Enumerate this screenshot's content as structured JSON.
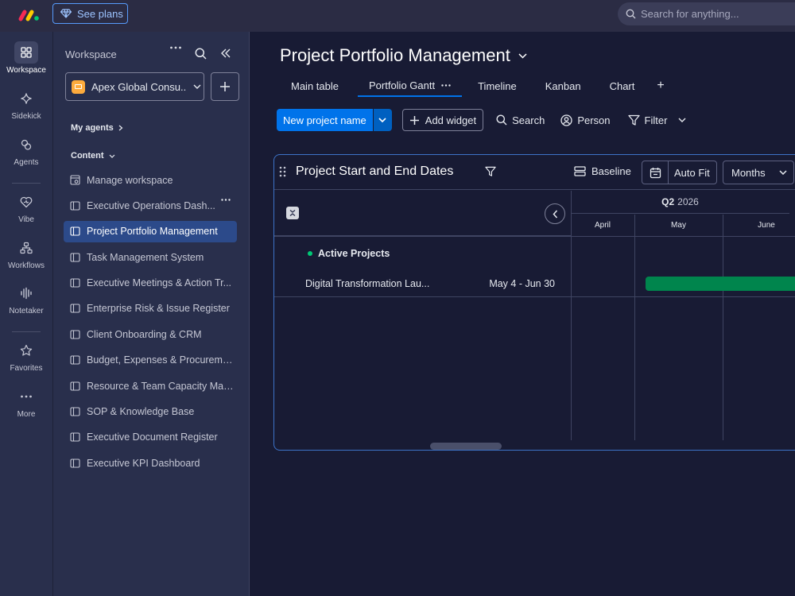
{
  "topbar": {
    "see_plans": "See plans",
    "search_placeholder": "Search for anything..."
  },
  "rail": {
    "items": [
      {
        "label": "Workspace",
        "icon": "grid-icon"
      },
      {
        "label": "Sidekick",
        "icon": "sparkle-icon"
      },
      {
        "label": "Agents",
        "icon": "agent-icon"
      },
      {
        "label": "Vibe",
        "icon": "heart-icon"
      },
      {
        "label": "Workflows",
        "icon": "workflow-icon"
      },
      {
        "label": "Notetaker",
        "icon": "audio-wave-icon"
      },
      {
        "label": "Favorites",
        "icon": "star-icon"
      },
      {
        "label": "More",
        "icon": "more-icon"
      }
    ]
  },
  "sidebar": {
    "title": "Workspace",
    "workspace_name": "Apex Global Consu...",
    "my_agents": "My agents",
    "content": "Content",
    "items": [
      {
        "label": "Manage workspace",
        "icon": "manage-workspace-icon"
      },
      {
        "label": "Executive Operations Dash...",
        "icon": "board-icon"
      },
      {
        "label": "Project Portfolio Management",
        "icon": "board-icon"
      },
      {
        "label": "Task Management System",
        "icon": "board-icon"
      },
      {
        "label": "Executive Meetings & Action Tr...",
        "icon": "board-icon"
      },
      {
        "label": "Enterprise Risk & Issue Register",
        "icon": "board-icon"
      },
      {
        "label": "Client Onboarding & CRM",
        "icon": "board-icon"
      },
      {
        "label": "Budget, Expenses & Procureme...",
        "icon": "board-icon"
      },
      {
        "label": "Resource & Team Capacity Man...",
        "icon": "board-icon"
      },
      {
        "label": "SOP & Knowledge Base",
        "icon": "board-icon"
      },
      {
        "label": "Executive Document Register",
        "icon": "board-icon"
      },
      {
        "label": "Executive KPI Dashboard",
        "icon": "board-icon"
      }
    ]
  },
  "main": {
    "title": "Project Portfolio Management",
    "tabs": [
      {
        "label": "Main table"
      },
      {
        "label": "Portfolio Gantt"
      },
      {
        "label": "Timeline"
      },
      {
        "label": "Kanban"
      },
      {
        "label": "Chart"
      }
    ],
    "add_view": "+",
    "toolbar": {
      "new_item": "New project name",
      "add_widget": "Add widget",
      "search": "Search",
      "person": "Person",
      "filter": "Filter"
    }
  },
  "widget": {
    "title": "Project Start and End Dates",
    "baseline": "Baseline",
    "auto_fit": "Auto Fit",
    "scale": "Months",
    "quarter": "Q2",
    "year": "2026",
    "months": [
      "April",
      "May",
      "June"
    ],
    "group": "Active Projects",
    "item": {
      "name": "Digital Transformation Lau...",
      "dates": "May 4 - Jun 30"
    }
  },
  "colors": {
    "accent": "#0073ea",
    "group": "#00c875",
    "bar": "#00854d"
  }
}
